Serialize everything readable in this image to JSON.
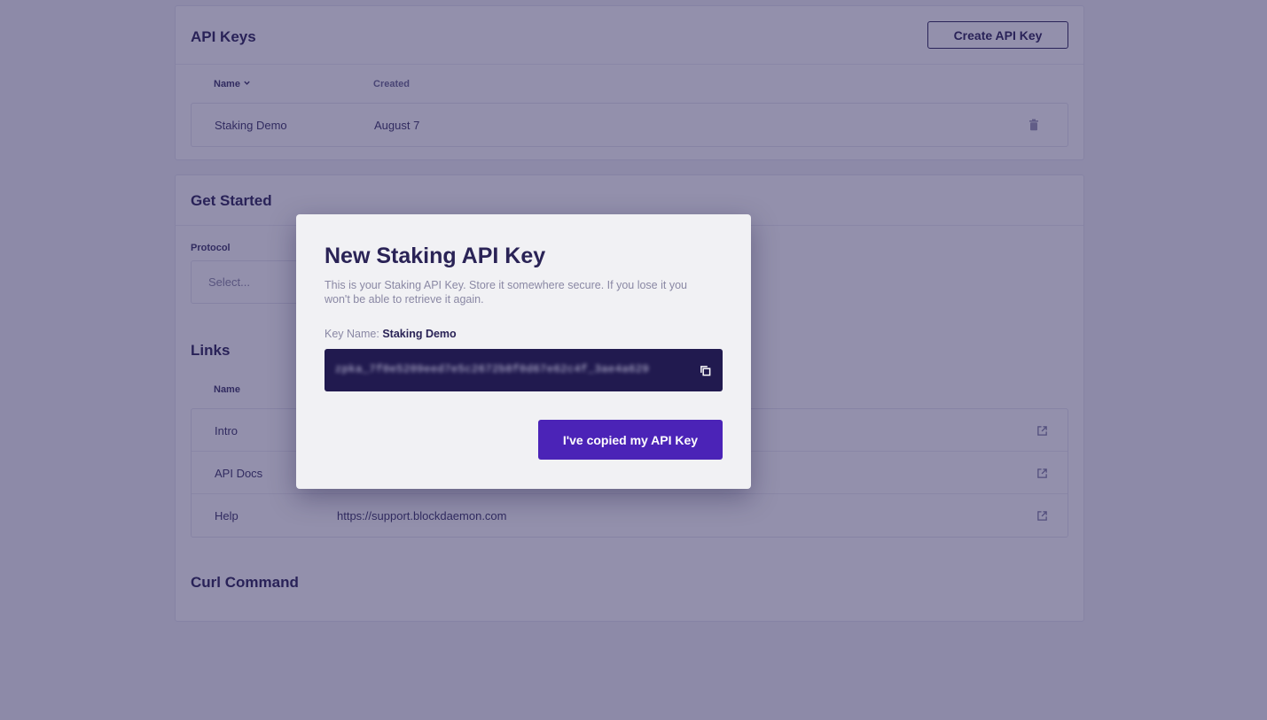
{
  "api_keys": {
    "title": "API Keys",
    "create_button": "Create API Key",
    "columns": {
      "name": "Name",
      "created": "Created"
    },
    "rows": [
      {
        "name": "Staking Demo",
        "created": "August 7"
      }
    ]
  },
  "get_started": {
    "title": "Get Started",
    "protocol_label": "Protocol",
    "protocol_placeholder": "Select...",
    "links_title": "Links",
    "links_column_name": "Name",
    "links": [
      {
        "name": "Intro",
        "url": ""
      },
      {
        "name": "API Docs",
        "url": ""
      },
      {
        "name": "Help",
        "url": "https://support.blockdaemon.com"
      }
    ],
    "curl_title": "Curl Command"
  },
  "modal": {
    "title": "New Staking API Key",
    "description": "This is your Staking API Key. Store it somewhere secure. If you lose it you won't be able to retrieve it again.",
    "key_name_label": "Key Name:",
    "key_name_value": "Staking Demo",
    "key_value": "zpka_7f0e5209eed7e5c2672b8f0d67e62c4f_3ae4a629",
    "confirm_button": "I've copied my API Key"
  },
  "colors": {
    "accent": "#4b23b7",
    "key_box": "#211a4f",
    "text_primary": "#2a2356",
    "overlay": "rgba(40,34,90,0.5)"
  },
  "icons": {
    "sort": "chevron-down-icon",
    "delete": "trash-icon",
    "external": "external-link-icon",
    "copy": "copy-icon"
  }
}
